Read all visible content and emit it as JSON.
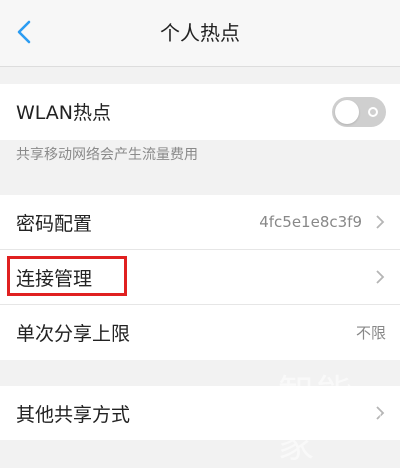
{
  "header": {
    "title": "个人热点",
    "back_icon": "chevron-left-icon",
    "accent_color": "#2b9cf2"
  },
  "wlan": {
    "label": "WLAN热点",
    "enabled": false,
    "hint": "共享移动网络会产生流量费用"
  },
  "settings": {
    "password_label": "密码配置",
    "password_value": "4fc5e1e8c3f9",
    "connection_label": "连接管理",
    "limit_label": "单次分享上限",
    "limit_value": "不限",
    "other_label": "其他共享方式"
  },
  "watermark": {
    "text": "智能家",
    "url": "www.znj.com"
  }
}
